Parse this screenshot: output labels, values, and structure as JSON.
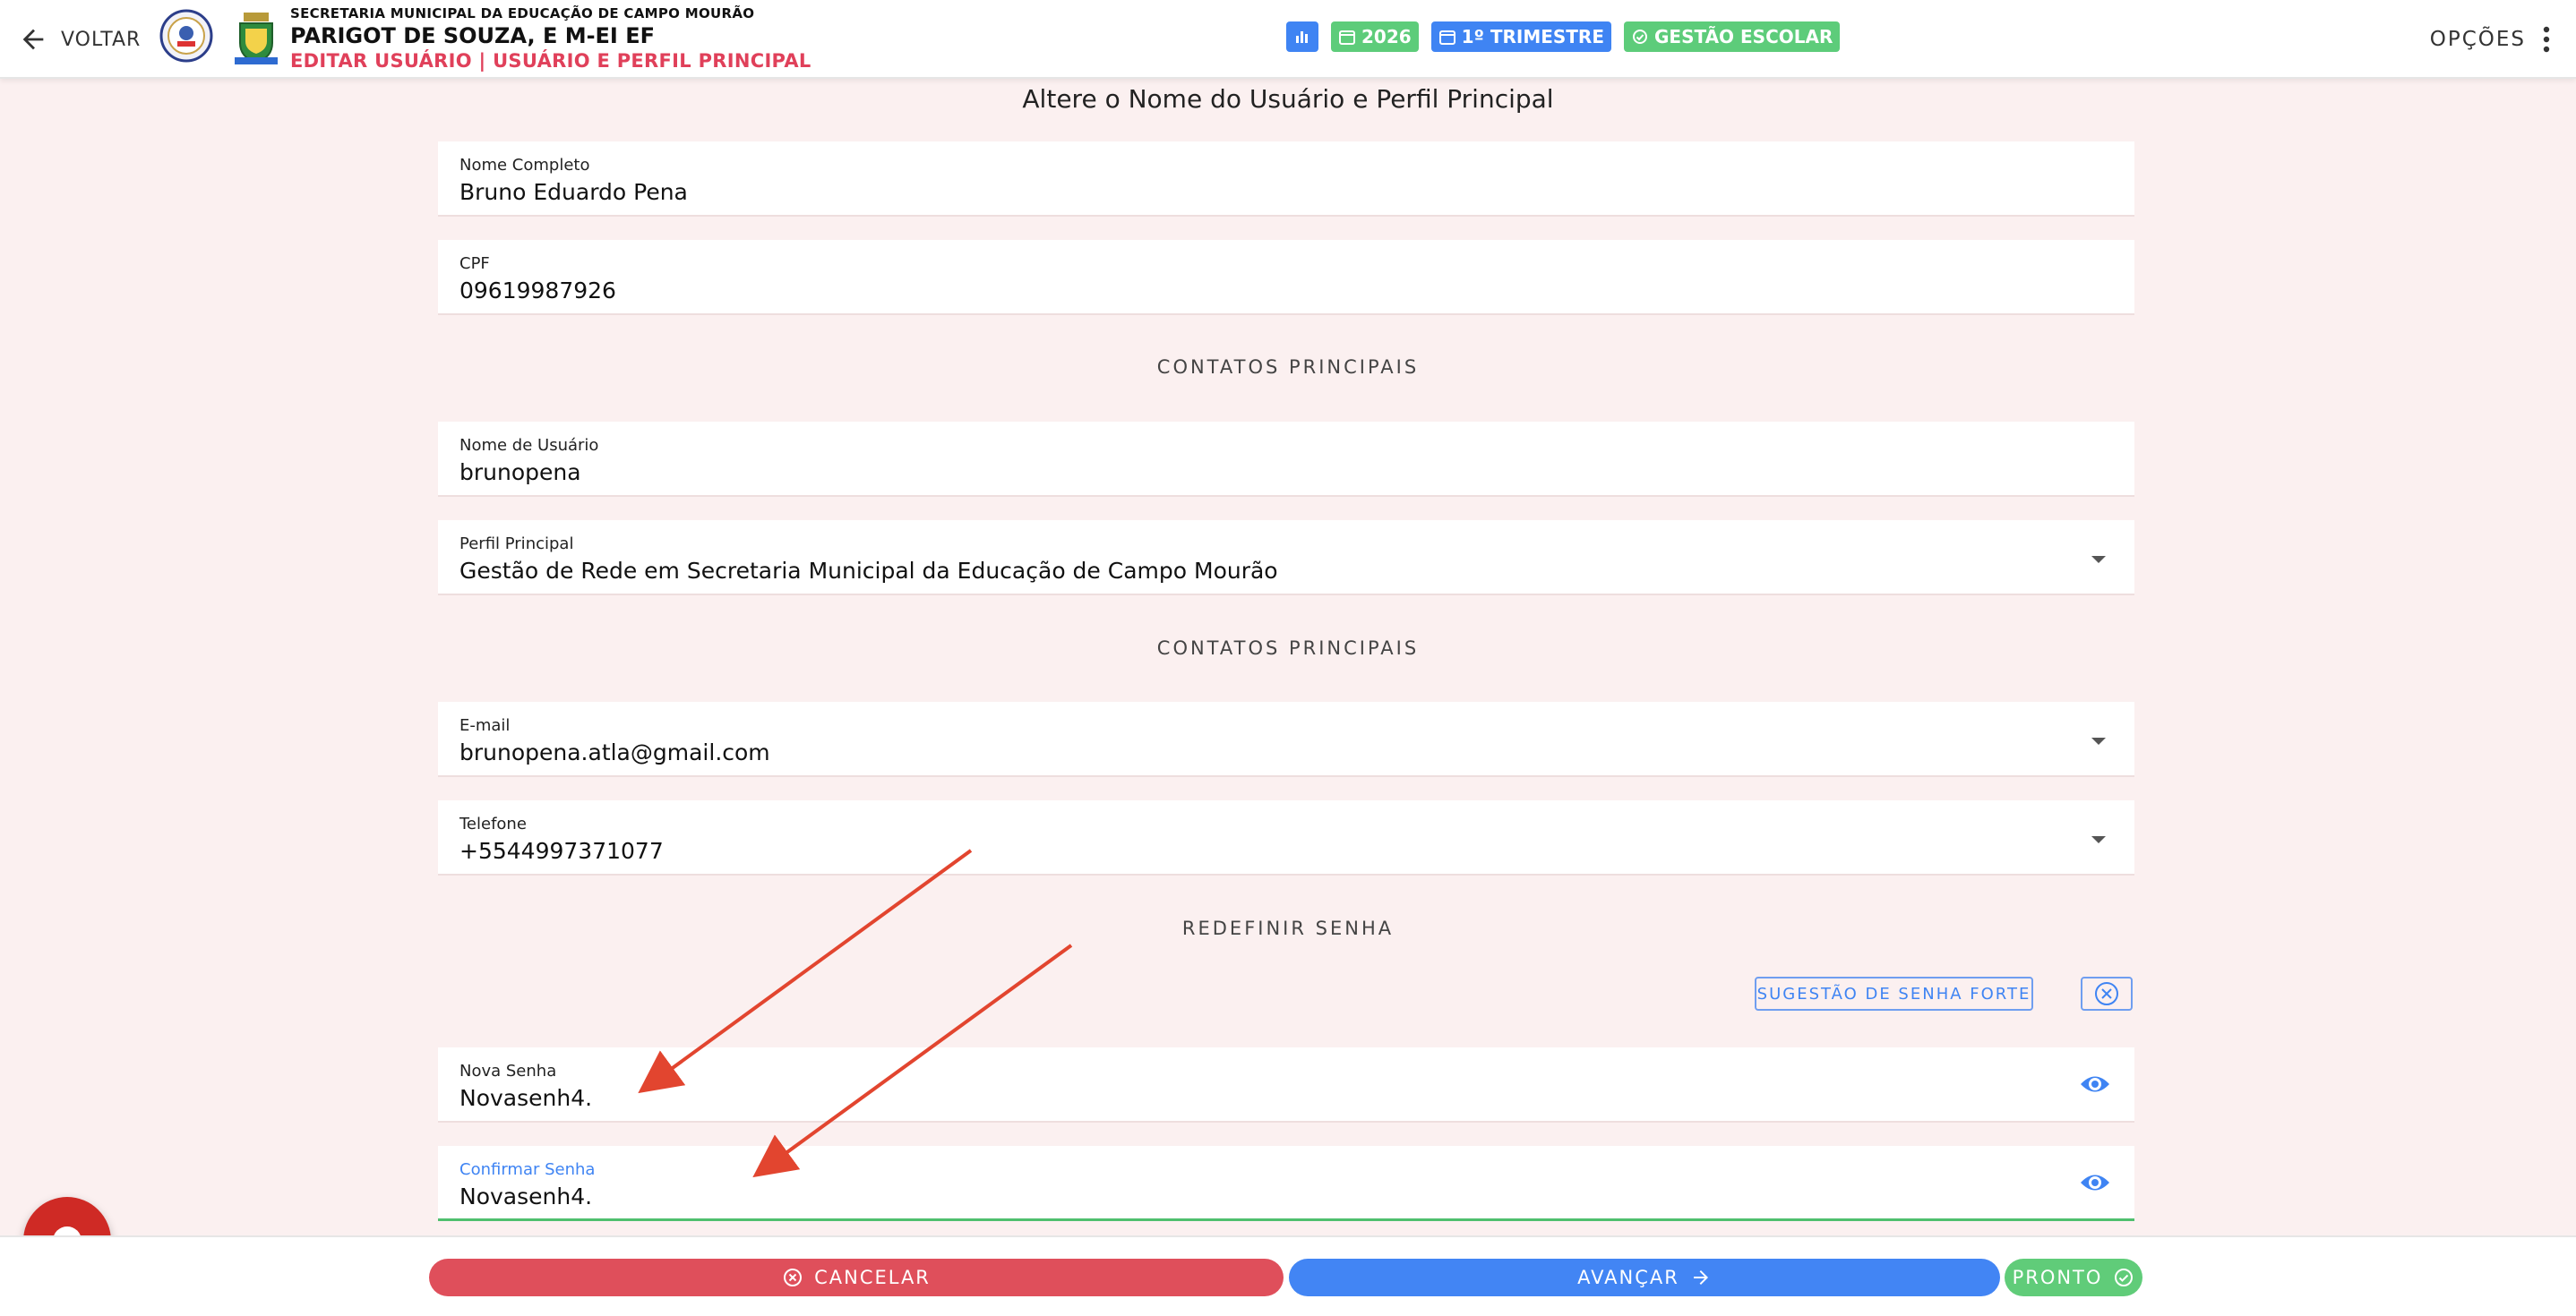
{
  "header": {
    "back_label": "VOLTAR",
    "secretaria": "SECRETARIA MUNICIPAL DA EDUCAÇÃO DE CAMPO MOURÃO",
    "school": "PARIGOT DE SOUZA, E M-EI EF",
    "subtitle": "EDITAR USUÁRIO | USUÁRIO E PERFIL PRINCIPAL",
    "badges": {
      "chart_icon": "bar-chart-icon",
      "year": "2026",
      "period": "1º TRIMESTRE",
      "module": "GESTÃO ESCOLAR"
    },
    "options_label": "OPÇÕES"
  },
  "form": {
    "title": "Altere o Nome do Usuário e Perfil Principal",
    "nome_completo": {
      "label": "Nome Completo",
      "value": "Bruno Eduardo Pena"
    },
    "cpf": {
      "label": "CPF",
      "value": "09619987926"
    },
    "section_1": "CONTATOS PRINCIPAIS",
    "usuario": {
      "label": "Nome de Usuário",
      "value": "brunopena"
    },
    "perfil": {
      "label": "Perfil Principal",
      "value": "Gestão de Rede em Secretaria Municipal da Educação de Campo Mourão"
    },
    "section_2": "CONTATOS PRINCIPAIS",
    "email": {
      "label": "E-mail",
      "value": "brunopena.atla@gmail.com"
    },
    "telefone": {
      "label": "Telefone",
      "value": "+5544997371077"
    },
    "section_3": "REDEFINIR SENHA",
    "strong_password_label": "SUGESTÃO DE SENHA FORTE",
    "nova_senha": {
      "label": "Nova Senha",
      "value": "Novasenh4."
    },
    "confirmar_senha": {
      "label": "Confirmar Senha",
      "value": "Novasenh4."
    }
  },
  "footer": {
    "cancel_label": "CANCELAR",
    "next_label": "AVANÇAR",
    "done_label": "PRONTO"
  },
  "colors": {
    "accent_blue": "#4285f4",
    "accent_green": "#60cc79",
    "danger_red": "#df4f5b",
    "subtitle_red": "#e0405a",
    "annotation_arrow": "#e2452f"
  }
}
